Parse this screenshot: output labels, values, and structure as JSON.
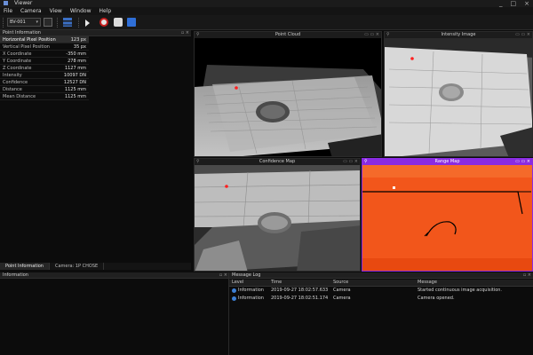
{
  "window": {
    "title": "Viewer",
    "min": "_",
    "max": "□",
    "close": "×"
  },
  "menu": [
    "File",
    "Camera",
    "View",
    "Window",
    "Help"
  ],
  "toolbar": {
    "device": "BV-001",
    "dropdown_caret": "▾"
  },
  "features_panel": {
    "title": "Point Information",
    "rows": [
      {
        "key": "Horizontal Pixel Position",
        "value": "123 px"
      },
      {
        "key": "Vertical Pixel Position",
        "value": "35 px"
      },
      {
        "key": "X Coordinate",
        "value": "-350 mm"
      },
      {
        "key": "Y Coordinate",
        "value": "278 mm"
      },
      {
        "key": "Z Coordinate",
        "value": "1127 mm"
      },
      {
        "key": "Intensity",
        "value": "10097 DN"
      },
      {
        "key": "Confidence",
        "value": "12527 DN"
      },
      {
        "key": "Distance",
        "value": "1125 mm"
      },
      {
        "key": "Mean Distance",
        "value": "1125 mm"
      }
    ]
  },
  "bottom_tabs": [
    "Point Information",
    "Camera: 1P CHOSE"
  ],
  "bottom_left_panel": {
    "title": "Information"
  },
  "views": [
    {
      "title": "Point Cloud"
    },
    {
      "title": "Intensity Image"
    },
    {
      "title": "Confidence Map"
    },
    {
      "title": "Range Map"
    }
  ],
  "log_panel": {
    "title": "Message Log",
    "columns": [
      "Level",
      "Time",
      "Source",
      "Message"
    ],
    "rows": [
      {
        "level": "Information",
        "time": "2019-09-27 18:02:57.633",
        "source": "Camera",
        "message": "Started continuous image acquisition."
      },
      {
        "level": "Information",
        "time": "2019-09-27 18:02:51.174",
        "source": "Camera",
        "message": "Camera opened."
      }
    ]
  },
  "colors": {
    "range_map": "#f2561b",
    "accent": "#8a2be2",
    "marker": "#ff2020"
  }
}
